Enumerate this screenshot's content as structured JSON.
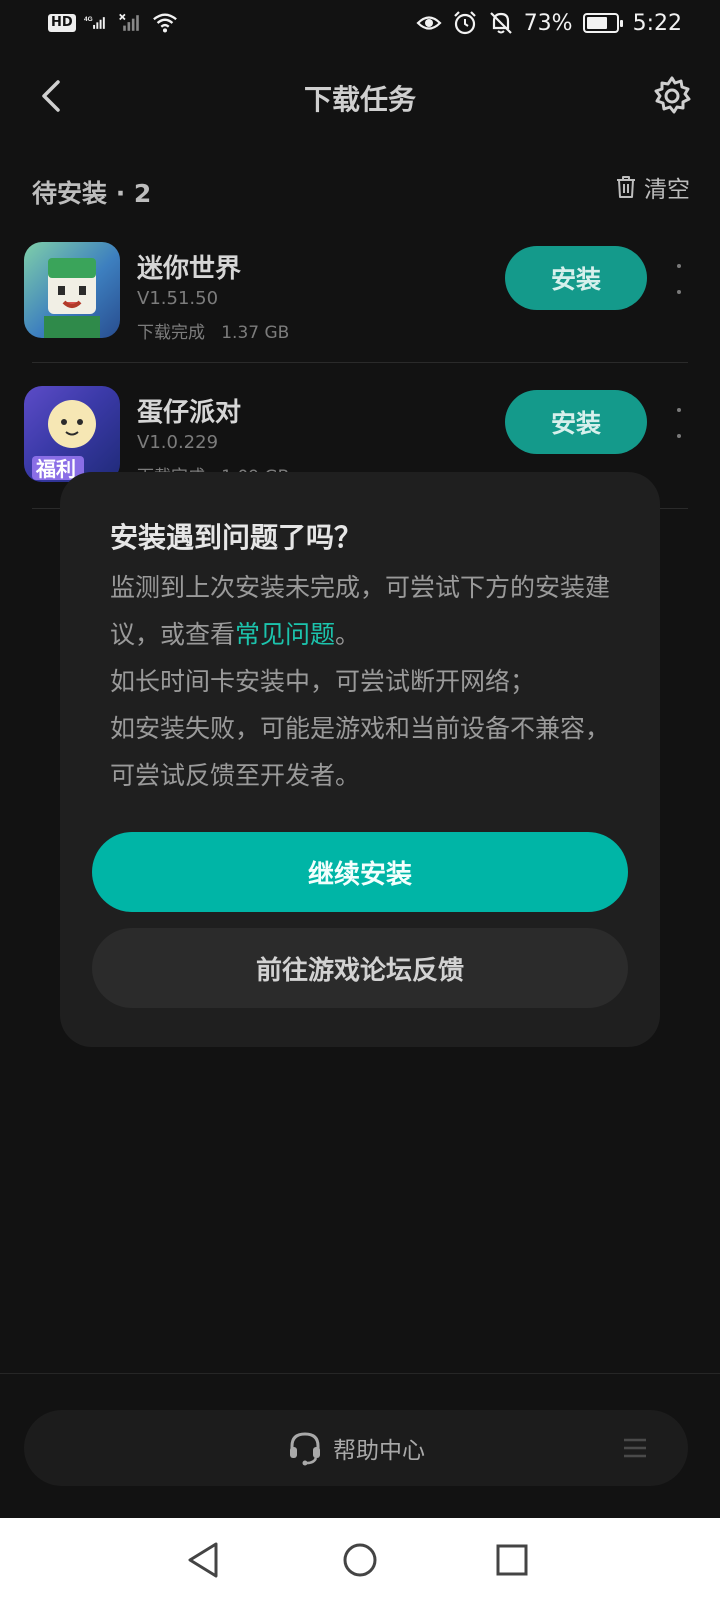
{
  "status_bar": {
    "hd_label": "HD",
    "network": "4G",
    "battery": "73%",
    "battery_level": 0.73,
    "time": "5:22"
  },
  "header": {
    "title": "下载任务"
  },
  "pending": {
    "title": "待安装 · 2",
    "clear_label": "清空",
    "items": [
      {
        "name": "迷你世界",
        "version": "V1.51.50",
        "status": "下载完成",
        "size": "1.37 GB",
        "button": "安装"
      },
      {
        "name": "蛋仔派对",
        "version": "V1.0.229",
        "status": "下载完成",
        "size": "1.09 GB",
        "button": "安装"
      }
    ]
  },
  "icon_label": "福利",
  "dialog": {
    "title": "安装遇到问题了吗？",
    "line1_prefix": "监测到上次安装未完成，可尝试下方的安装建议，或查看",
    "line1_link": "常见问题",
    "line1_suffix": "。",
    "line2": "如长时间卡安装中，可尝试断开网络；",
    "line3": "如安装失败，可能是游戏和当前设备不兼容，可尝试反馈至开发者。",
    "primary_button": "继续安装",
    "secondary_button": "前往游戏论坛反馈"
  },
  "bottom": {
    "help_label": "帮助中心"
  },
  "colors": {
    "accent": "#00b5a6",
    "install_button": "#149a8b",
    "background": "#121212",
    "dialog": "#1f1f1f"
  }
}
